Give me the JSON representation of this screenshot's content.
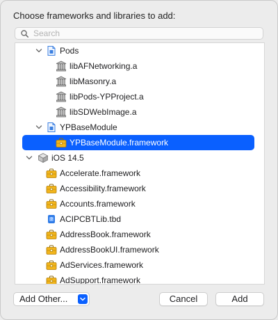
{
  "dialog": {
    "title": "Choose frameworks and libraries to add:"
  },
  "search": {
    "placeholder": "Search",
    "value": ""
  },
  "tree": {
    "pods_group": "Pods",
    "pods_items": [
      "libAFNetworking.a",
      "libMasonry.a",
      "libPods-YPProject.a",
      "libSDWebImage.a"
    ],
    "module_group": "YPBaseModule",
    "module_item_selected": "YPBaseModule.framework",
    "sdk_group": "iOS 14.5",
    "sdk_items": [
      {
        "label": "Accelerate.framework",
        "icon": "framework-toolbox-icon"
      },
      {
        "label": "Accessibility.framework",
        "icon": "framework-toolbox-icon"
      },
      {
        "label": "Accounts.framework",
        "icon": "framework-toolbox-icon"
      },
      {
        "label": "ACIPCBTLib.tbd",
        "icon": "tbd-file-icon"
      },
      {
        "label": "AddressBook.framework",
        "icon": "framework-toolbox-icon"
      },
      {
        "label": "AddressBookUI.framework",
        "icon": "framework-toolbox-icon"
      },
      {
        "label": "AdServices.framework",
        "icon": "framework-toolbox-icon"
      },
      {
        "label": "AdSupport.framework",
        "icon": "framework-toolbox-icon"
      }
    ]
  },
  "footer": {
    "add_other_label": "Add Other...",
    "cancel_label": "Cancel",
    "add_label": "Add"
  },
  "colors": {
    "selection": "#0a60ff",
    "framework_icon": "#f2b51c"
  }
}
